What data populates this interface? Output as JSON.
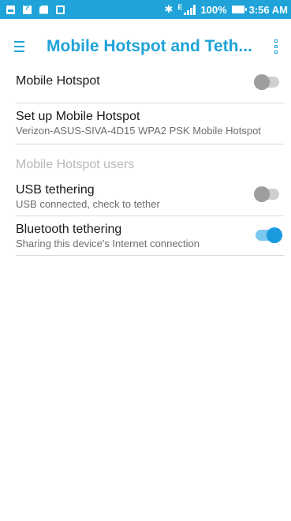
{
  "status_bar": {
    "signal_label": "E",
    "battery": "100%",
    "time": "3:56 AM"
  },
  "app_bar": {
    "title": "Mobile Hotspot and Teth..."
  },
  "settings": {
    "mobile_hotspot": {
      "title": "Mobile Hotspot",
      "enabled": false
    },
    "setup_hotspot": {
      "title": "Set up Mobile Hotspot",
      "subtitle": "Verizon-ASUS-SIVA-4D15 WPA2 PSK Mobile Hotspot"
    },
    "hotspot_users": {
      "title": "Mobile Hotspot users"
    },
    "usb_tethering": {
      "title": "USB tethering",
      "subtitle": "USB connected, check to tether",
      "enabled": false
    },
    "bluetooth_tethering": {
      "title": "Bluetooth tethering",
      "subtitle": "Sharing this device's Internet connection",
      "enabled": true
    }
  },
  "colors": {
    "accent": "#1fa3d9",
    "toggle_on": "#1a9be0"
  }
}
